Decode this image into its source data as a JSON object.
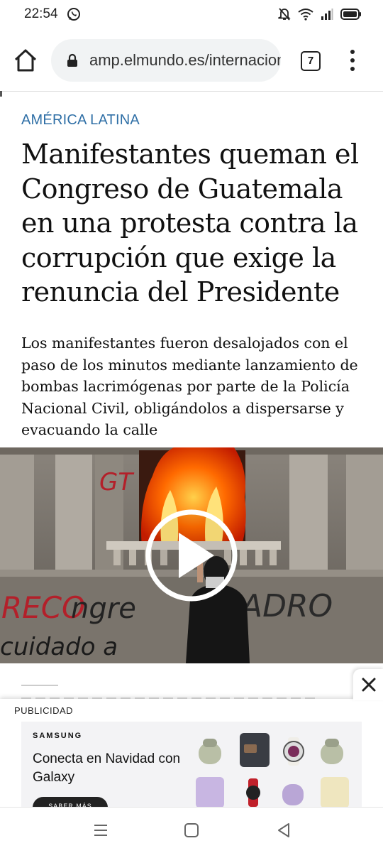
{
  "status_bar": {
    "time": "22:54",
    "icons": [
      "whatsapp-icon",
      "mute-bell-icon",
      "wifi-icon",
      "signal-icon",
      "battery-icon"
    ]
  },
  "browser": {
    "url": "amp.elmundo.es/internacional",
    "tab_count": "7",
    "icons": [
      "home-icon",
      "lock-icon",
      "menu-icon"
    ]
  },
  "article": {
    "section": "AMÉRICA LATINA",
    "headline": "Manifestantes queman el Congreso de Guatemala en una protesta contra la corrupción que exige la renuncia del Presidente",
    "summary": "Los manifestantes fueron desalojados con el paso de los minutos mediante lanzamiento de bombas lacrimógenas por parte de la Policía Nacional Civil, obligándolos a dispersarse y evacuando la calle"
  },
  "media": {
    "type": "video",
    "play_icon": "play-icon"
  },
  "ad": {
    "label": "PUBLICIDAD",
    "brand": "SAMSUNG",
    "headline": "Conecta en Navidad con Galaxy",
    "cta": "SABER MÁS",
    "close_icon": "close-icon"
  },
  "nav_bar": {
    "icons": [
      "recents-icon",
      "home-nav-icon",
      "back-icon"
    ]
  },
  "colors": {
    "section": "#2f6fa6",
    "text": "#111111",
    "url_pill": "#f1f3f4"
  }
}
